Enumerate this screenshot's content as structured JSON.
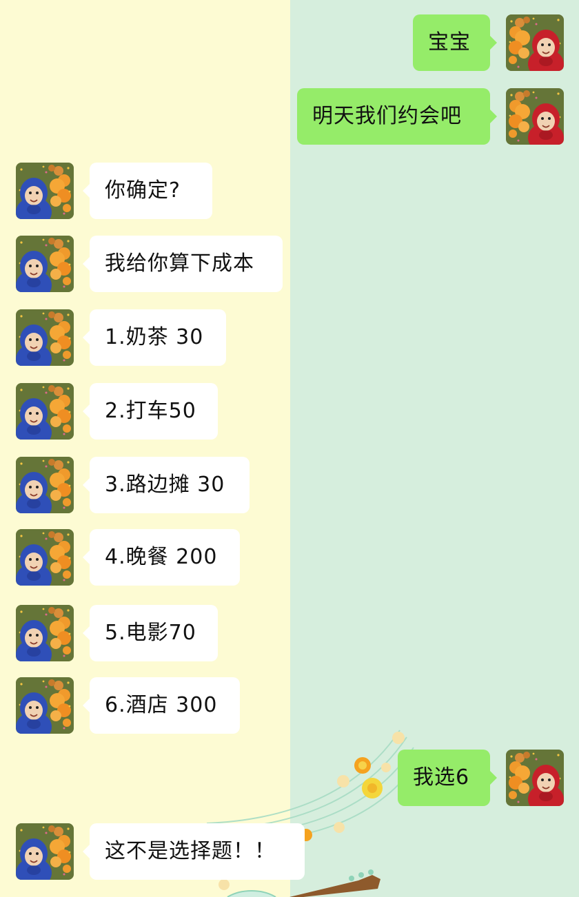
{
  "chat": {
    "messages": [
      {
        "side": "out",
        "text": "宝宝"
      },
      {
        "side": "out",
        "text": "明天我们约会吧"
      },
      {
        "side": "in",
        "text": "你确定?"
      },
      {
        "side": "in",
        "text": "我给你算下成本"
      },
      {
        "side": "in",
        "text": "1.奶茶 30"
      },
      {
        "side": "in",
        "text": "2.打车50"
      },
      {
        "side": "in",
        "text": "3.路边摊 30"
      },
      {
        "side": "in",
        "text": "4.晚餐 200"
      },
      {
        "side": "in",
        "text": "5.电影70"
      },
      {
        "side": "in",
        "text": "6.酒店 300"
      },
      {
        "side": "out",
        "text": "我选6"
      },
      {
        "side": "in",
        "text": "这不是选择题！！"
      }
    ],
    "avatars": {
      "in": "blue-teletubby-avatar",
      "out": "red-teletubby-avatar"
    }
  },
  "colors": {
    "left_background": "#fdfbd3",
    "right_background": "#d6eedd",
    "incoming_bubble": "#ffffff",
    "outgoing_bubble": "#95ec69"
  }
}
